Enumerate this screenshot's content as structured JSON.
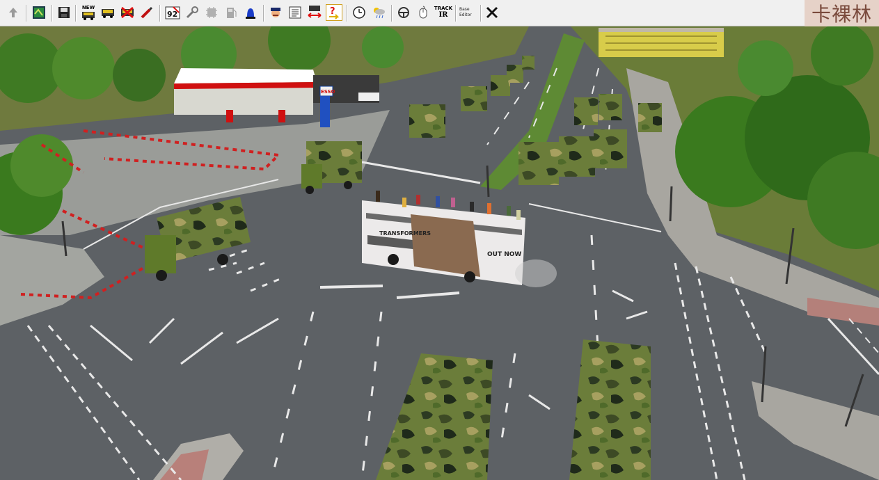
{
  "toolbar": {
    "buttons": [
      {
        "name": "up-arrow-icon"
      },
      {
        "name": "map-icon"
      },
      {
        "name": "save-icon"
      },
      {
        "name": "new-vehicle-icon",
        "label": "NEW"
      },
      {
        "name": "vehicle-icon"
      },
      {
        "name": "delete-vehicle-icon"
      },
      {
        "name": "edit-icon"
      },
      {
        "name": "timetable-icon"
      },
      {
        "name": "wrench-icon"
      },
      {
        "name": "chip-icon"
      },
      {
        "name": "fuel-icon"
      },
      {
        "name": "blue-light-icon"
      },
      {
        "name": "driver-icon"
      },
      {
        "name": "list-icon"
      },
      {
        "name": "swap-icon"
      },
      {
        "name": "help-icon"
      },
      {
        "name": "clock-icon"
      },
      {
        "name": "weather-icon"
      },
      {
        "name": "steering-wheel-icon"
      },
      {
        "name": "mouse-icon"
      },
      {
        "name": "trackir-icon",
        "label_top": "TRACK",
        "label_bottom": "IR"
      },
      {
        "name": "options-icon",
        "label_top": "Base",
        "label_bottom": "Editor"
      },
      {
        "name": "close-icon"
      }
    ]
  },
  "watermark": {
    "text": "卡裸林"
  },
  "scene": {
    "bus_sign": "OUT NOW",
    "bus_ad_text": "TRANSFORMERS",
    "gas_station_sign": "ESSO"
  },
  "colors": {
    "road": "#5d6165",
    "grass": "#6f7a3e",
    "tree": "#3f7a23",
    "camo_base": "#6b7d3a",
    "toolbar_bg": "#f0f0f0"
  }
}
